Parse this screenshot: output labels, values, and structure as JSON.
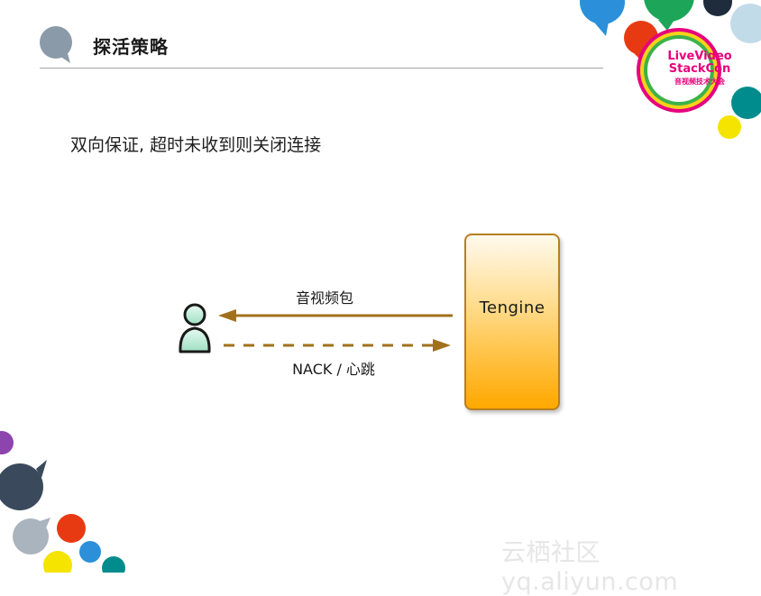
{
  "header": {
    "title": "探活策略"
  },
  "main": {
    "subtitle": "双向保证, 超时未收到则关闭连接"
  },
  "diagram": {
    "server_label": "Tengine",
    "top_arrow_label": "音视频包",
    "bottom_arrow_label": "NACK / 心跳"
  },
  "logo": {
    "line1": "LiveVideo",
    "line2": "StackCon",
    "line3": "音视频技术大会"
  },
  "watermark": {
    "text": "云栖社区 yq.aliyun.com"
  },
  "colors": {
    "arrow": "#a0701c",
    "server_border": "#b87f22",
    "server_fill_bottom": "#ffa800"
  }
}
